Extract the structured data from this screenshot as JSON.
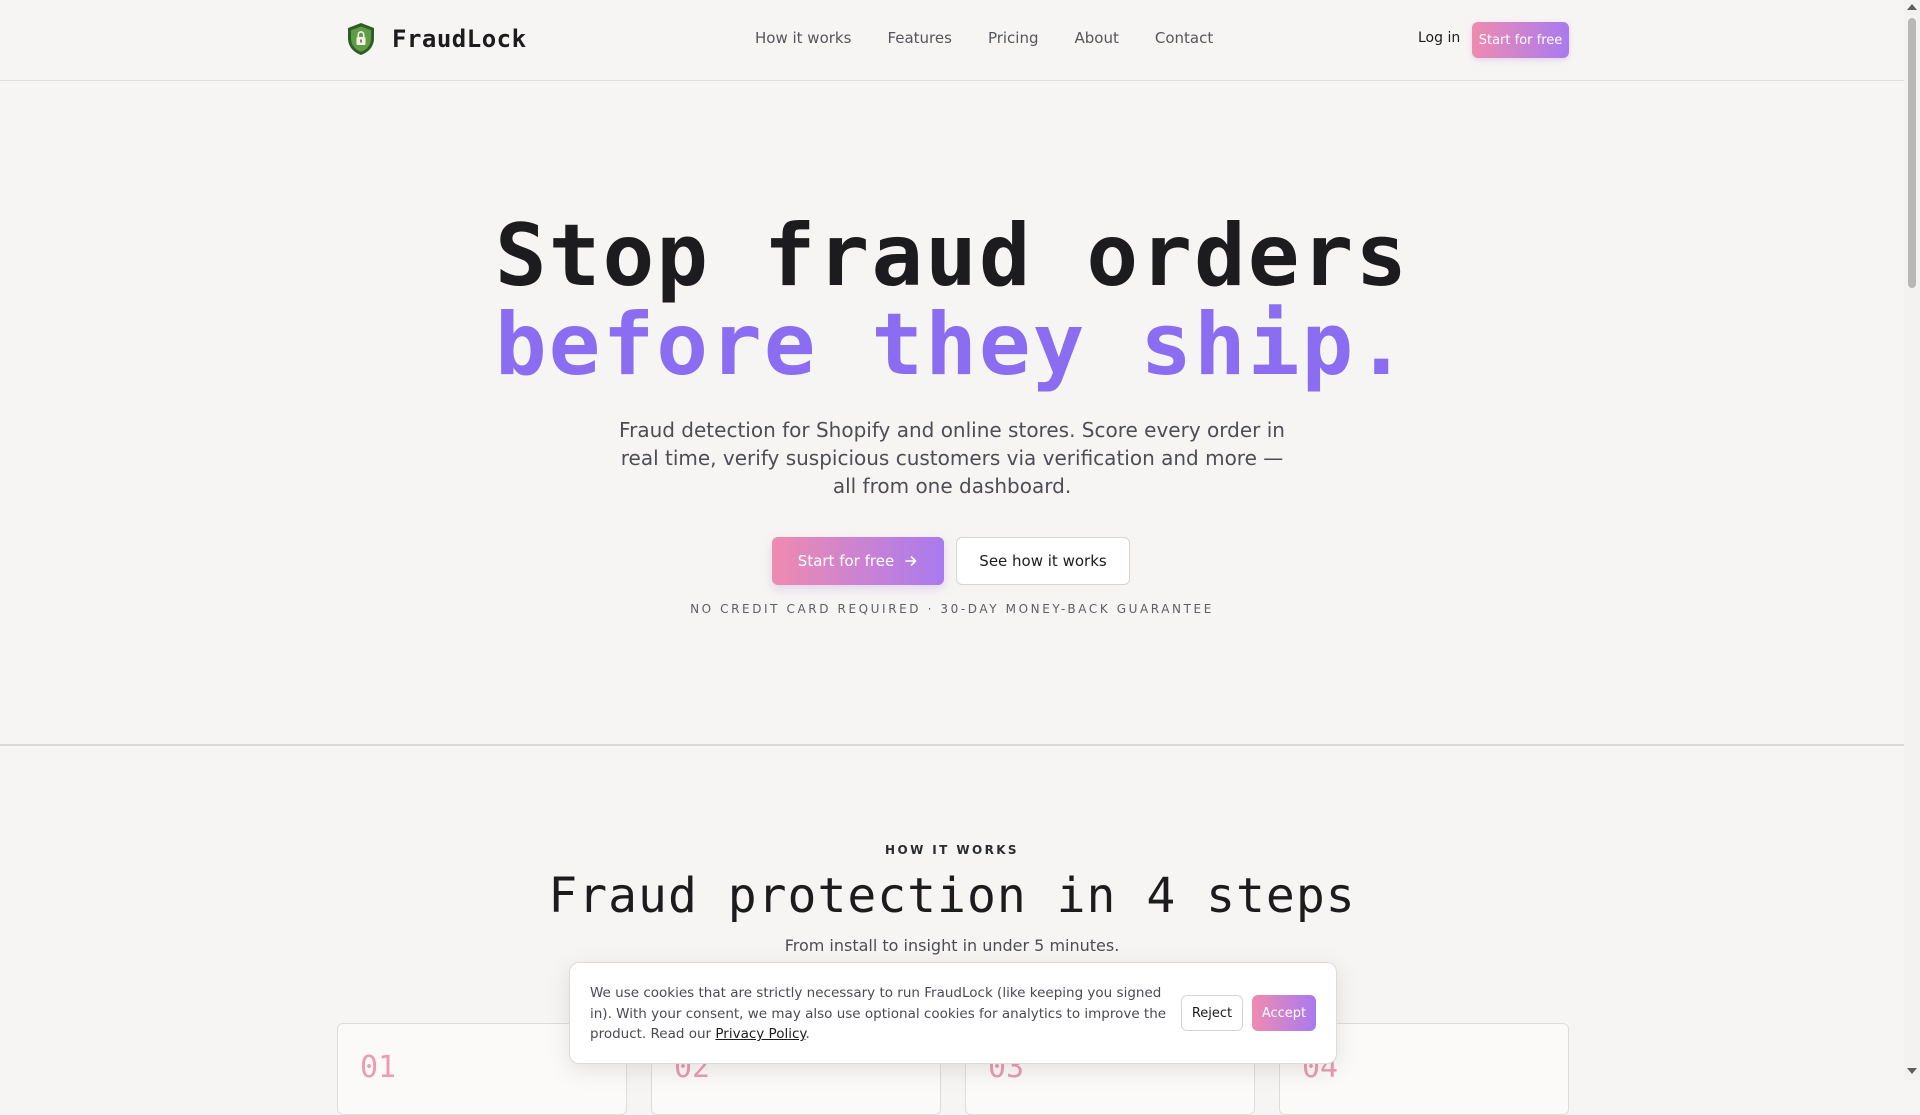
{
  "header": {
    "brand": "FraudLock",
    "nav": [
      {
        "label": "How it works"
      },
      {
        "label": "Features"
      },
      {
        "label": "Pricing"
      },
      {
        "label": "About"
      },
      {
        "label": "Contact"
      }
    ],
    "login_label": "Log in",
    "cta_label": "Start for free"
  },
  "hero": {
    "title_line1": "Stop fraud orders",
    "title_line2": "before they ship.",
    "subtitle": "Fraud detection for Shopify and online stores. Score every order in real time, verify suspicious customers via verification and more — all from one dashboard.",
    "primary_cta": "Start for free",
    "secondary_cta": "See how it works",
    "note": "NO CREDIT CARD REQUIRED · 30-DAY MONEY-BACK GUARANTEE"
  },
  "how_it_works": {
    "eyebrow": "HOW IT WORKS",
    "title": "Fraud protection in 4 steps",
    "subtitle": "From install to insight in under 5 minutes.",
    "steps": [
      {
        "number": "01"
      },
      {
        "number": "02"
      },
      {
        "number": "03"
      },
      {
        "number": "04"
      }
    ]
  },
  "cookie_banner": {
    "text": "We use cookies that are strictly necessary to run FraudLock (like keeping you signed in). With your consent, we may also use optional cookies for analytics to improve the product. Read our",
    "link": "Privacy Policy",
    "period": ".",
    "reject_label": "Reject",
    "accept_label": "Accept"
  },
  "colors": {
    "accent_purple": "#8a6df1",
    "gradient_start": "#ef8bb0",
    "gradient_end": "#a97af0",
    "background": "#f7f5f3",
    "logo_green": "#3f7a34"
  },
  "icons": {
    "logo": "shield-lock-icon",
    "cta_arrow": "arrow-right-icon"
  }
}
